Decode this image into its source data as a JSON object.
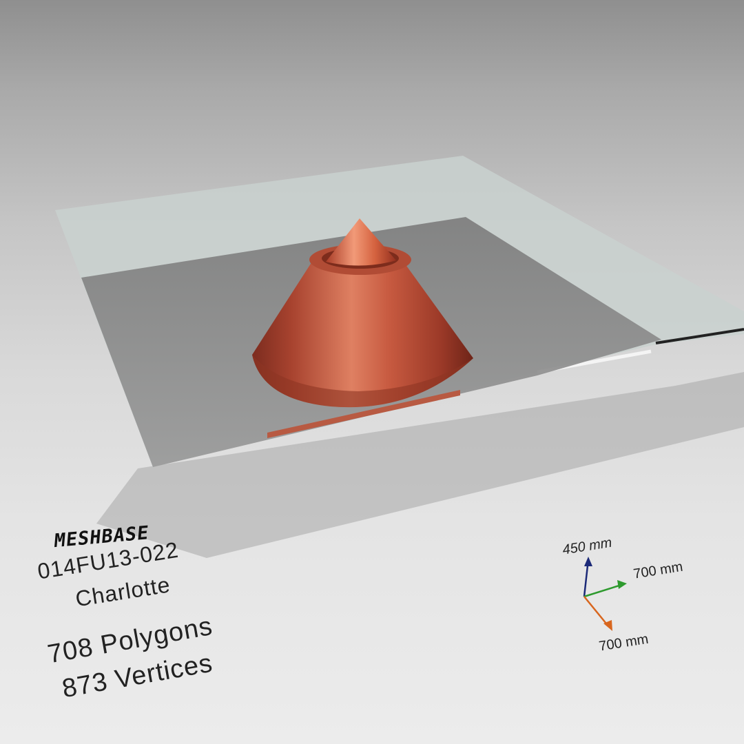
{
  "watermark": {
    "brand": "MESHBASE"
  },
  "model": {
    "code": "014FU13-022",
    "name": "Charlotte",
    "polygons": "708 Polygons",
    "vertices": "873 Vertices"
  },
  "dimensions": {
    "height": "450 mm",
    "width": "700 mm",
    "depth": "700 mm"
  },
  "colors": {
    "copper": "#c0573f",
    "axis_height": "#1c2a78",
    "axis_width": "#2e9a2e",
    "axis_depth": "#d8661e",
    "glass": "#c7cfcd"
  }
}
